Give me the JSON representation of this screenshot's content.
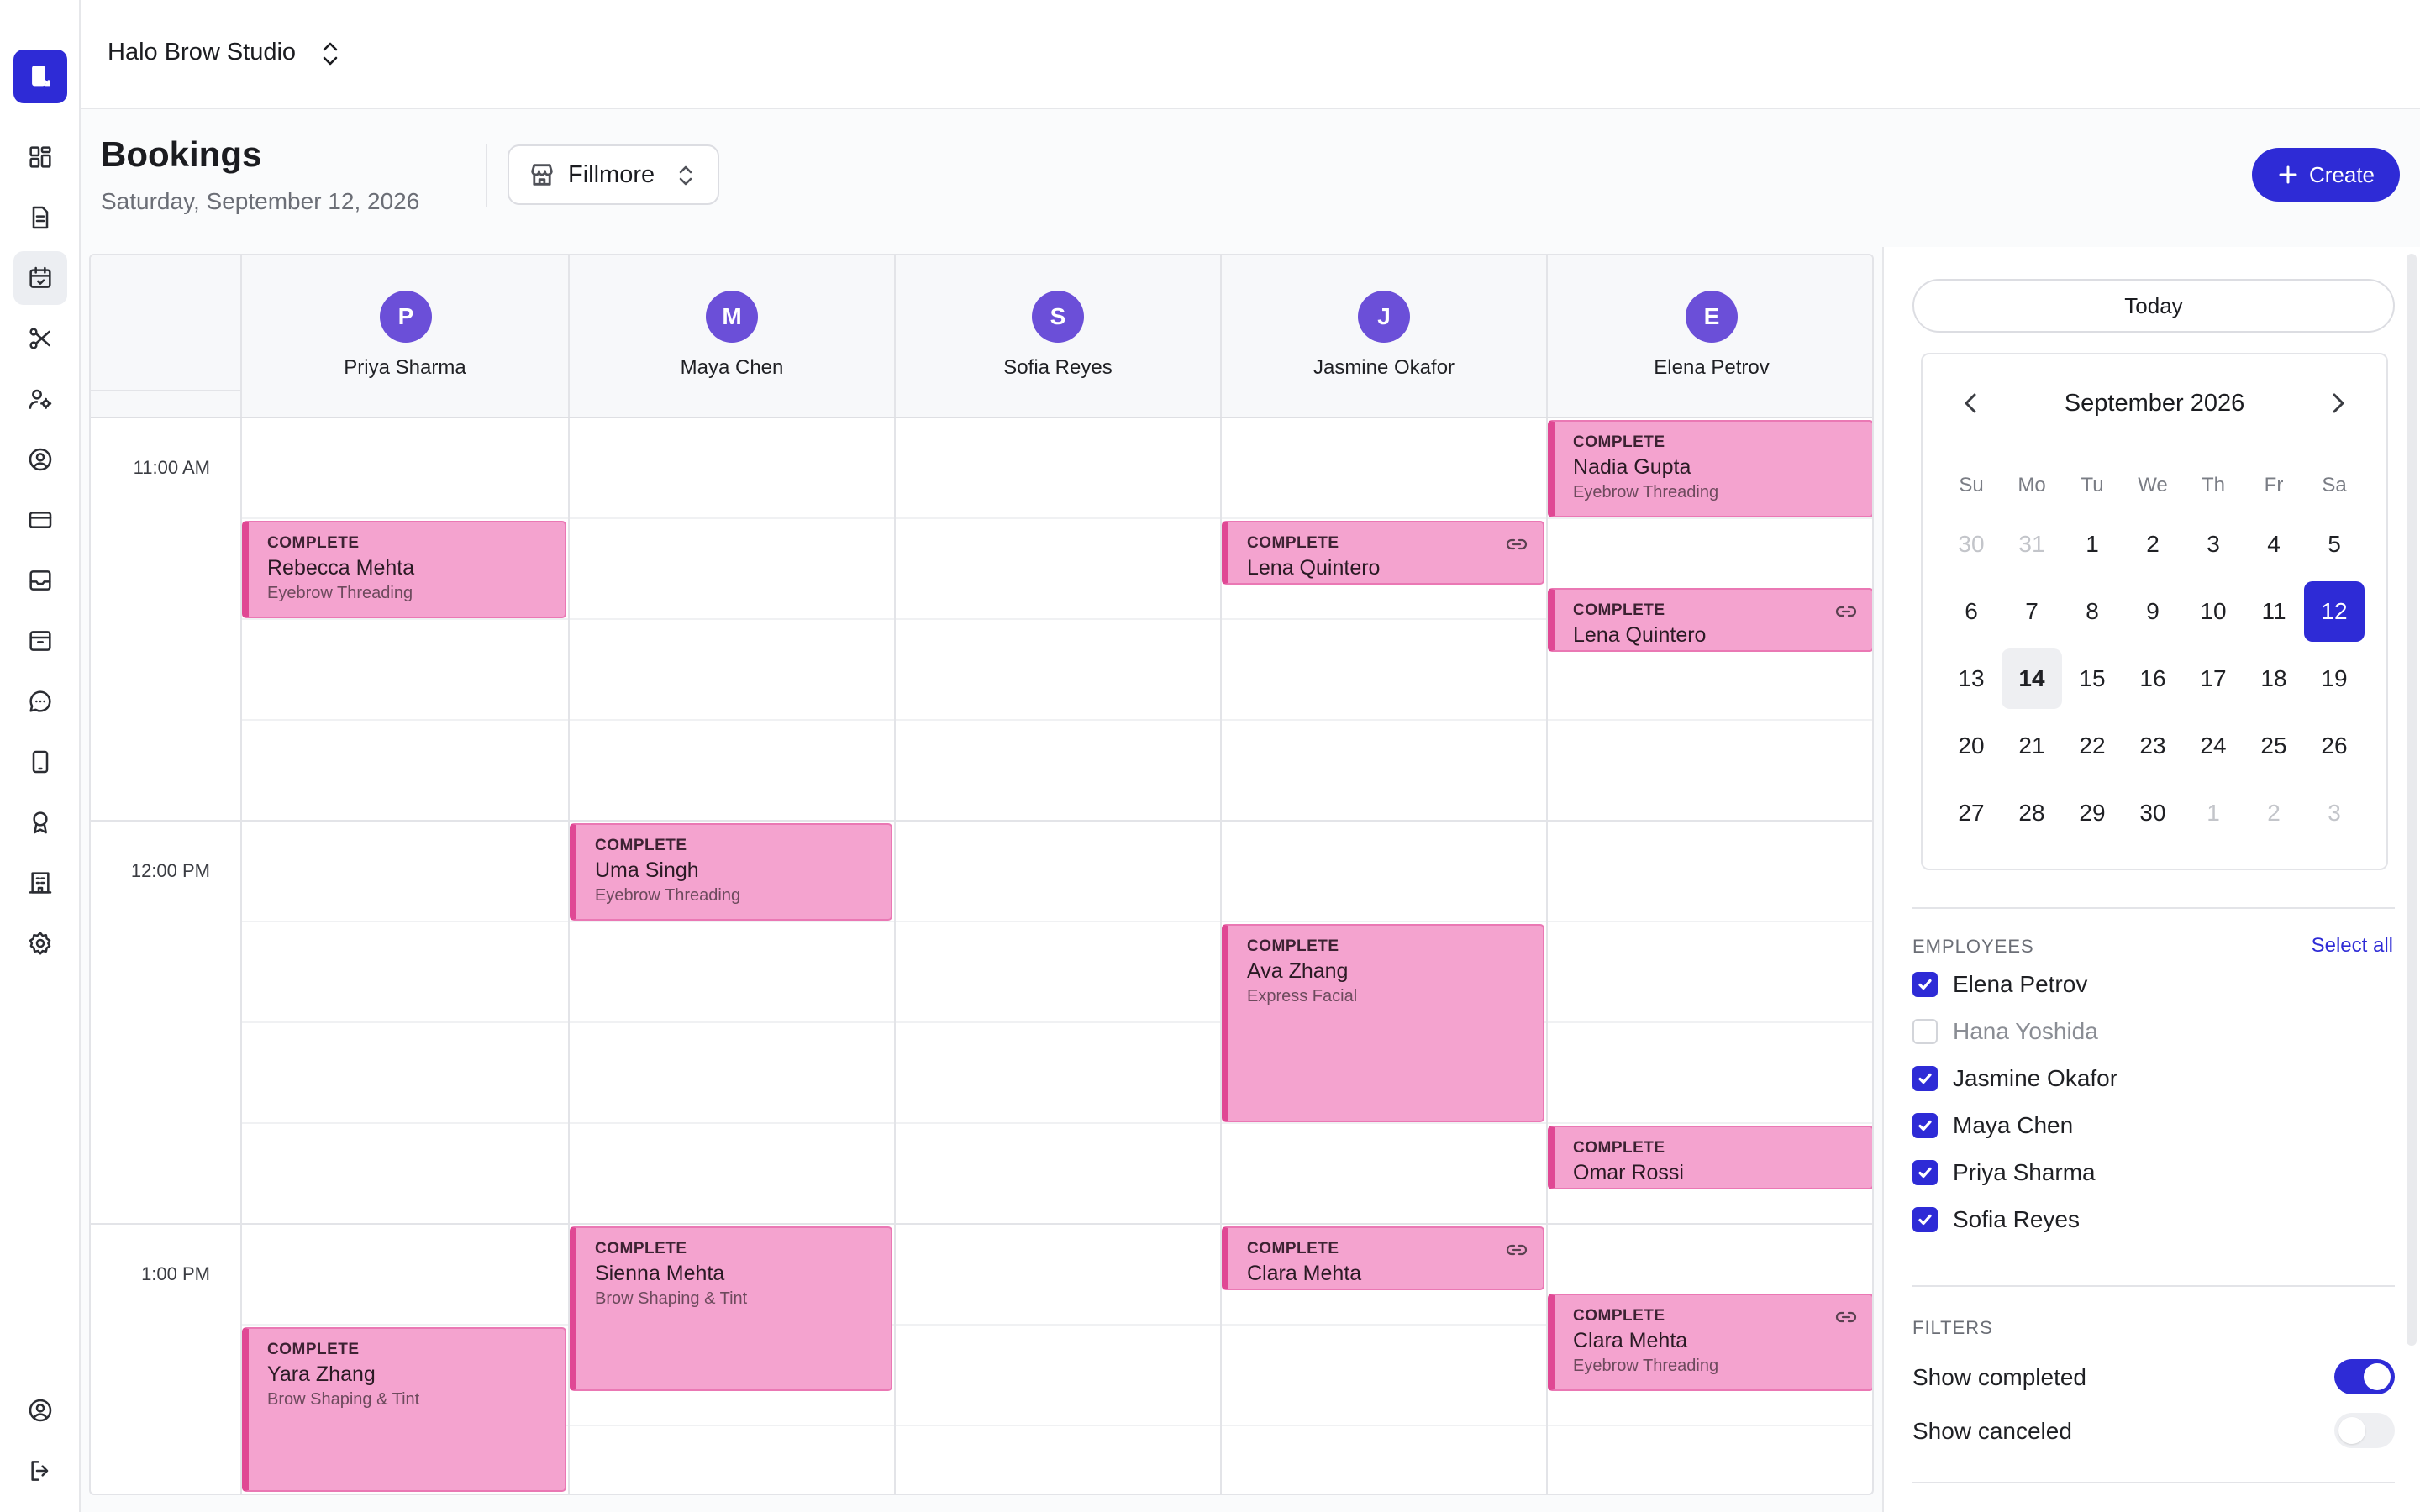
{
  "header": {
    "studio_name": "Halo Brow Studio"
  },
  "page": {
    "title": "Bookings",
    "date": "Saturday, September 12, 2026",
    "location": "Fillmore",
    "create_label": "Create"
  },
  "rail": {
    "icons": [
      "logo-icon",
      "dashboard-icon",
      "document-icon",
      "calendar-icon",
      "scissors-icon",
      "user-gear-icon",
      "user-circle-icon",
      "credit-card-icon",
      "inbox-icon",
      "archive-icon",
      "chat-icon",
      "tablet-icon",
      "award-icon",
      "building-icon",
      "settings-icon",
      "account-icon",
      "logout-icon"
    ],
    "active": "calendar-icon"
  },
  "calendar": {
    "employees": [
      {
        "initial": "P",
        "name": "Priya Sharma"
      },
      {
        "initial": "M",
        "name": "Maya Chen"
      },
      {
        "initial": "S",
        "name": "Sofia Reyes"
      },
      {
        "initial": "J",
        "name": "Jasmine Okafor"
      },
      {
        "initial": "E",
        "name": "Elena Petrov"
      }
    ],
    "times": [
      "11:00 AM",
      "12:00 PM",
      "1:00 PM"
    ],
    "events": [
      {
        "status": "COMPLETE",
        "client": "Nadia Gupta",
        "service": "Eyebrow Threading"
      },
      {
        "status": "COMPLETE",
        "client": "Rebecca Mehta",
        "service": "Eyebrow Threading"
      },
      {
        "status": "COMPLETE",
        "client": "Lena Quintero",
        "service": ""
      },
      {
        "status": "COMPLETE",
        "client": "Lena Quintero",
        "service": ""
      },
      {
        "status": "COMPLETE",
        "client": "Uma Singh",
        "service": "Eyebrow Threading"
      },
      {
        "status": "COMPLETE",
        "client": "Ava Zhang",
        "service": "Express Facial"
      },
      {
        "status": "COMPLETE",
        "client": "Omar Rossi",
        "service": ""
      },
      {
        "status": "COMPLETE",
        "client": "Sienna Mehta",
        "service": "Brow Shaping & Tint"
      },
      {
        "status": "COMPLETE",
        "client": "Clara Mehta",
        "service": ""
      },
      {
        "status": "COMPLETE",
        "client": "Clara Mehta",
        "service": "Eyebrow Threading"
      },
      {
        "status": "COMPLETE",
        "client": "Yara Zhang",
        "service": "Brow Shaping & Tint"
      }
    ],
    "event_color": "#f4a3cf",
    "event_accent": "#e04894"
  },
  "sidebar": {
    "today_label": "Today",
    "month_title": "September 2026",
    "weekdays": [
      "Su",
      "Mo",
      "Tu",
      "We",
      "Th",
      "Fr",
      "Sa"
    ],
    "weeks": [
      [
        "30",
        "31",
        "1",
        "2",
        "3",
        "4",
        "5"
      ],
      [
        "6",
        "7",
        "8",
        "9",
        "10",
        "11",
        "12"
      ],
      [
        "13",
        "14",
        "15",
        "16",
        "17",
        "18",
        "19"
      ],
      [
        "20",
        "21",
        "22",
        "23",
        "24",
        "25",
        "26"
      ],
      [
        "27",
        "28",
        "29",
        "30",
        "1",
        "2",
        "3"
      ]
    ],
    "selected_day": "12",
    "today_day": "14",
    "employees_label": "EMPLOYEES",
    "select_all_label": "Select all",
    "employee_filters": [
      {
        "name": "Elena Petrov",
        "checked": true
      },
      {
        "name": "Hana Yoshida",
        "checked": false
      },
      {
        "name": "Jasmine Okafor",
        "checked": true
      },
      {
        "name": "Maya Chen",
        "checked": true
      },
      {
        "name": "Priya Sharma",
        "checked": true
      },
      {
        "name": "Sofia Reyes",
        "checked": true
      }
    ],
    "filters_label": "FILTERS",
    "filters": [
      {
        "label": "Show completed",
        "on": true
      },
      {
        "label": "Show canceled",
        "on": false
      }
    ]
  },
  "colors": {
    "accent": "#2e2bd6"
  }
}
